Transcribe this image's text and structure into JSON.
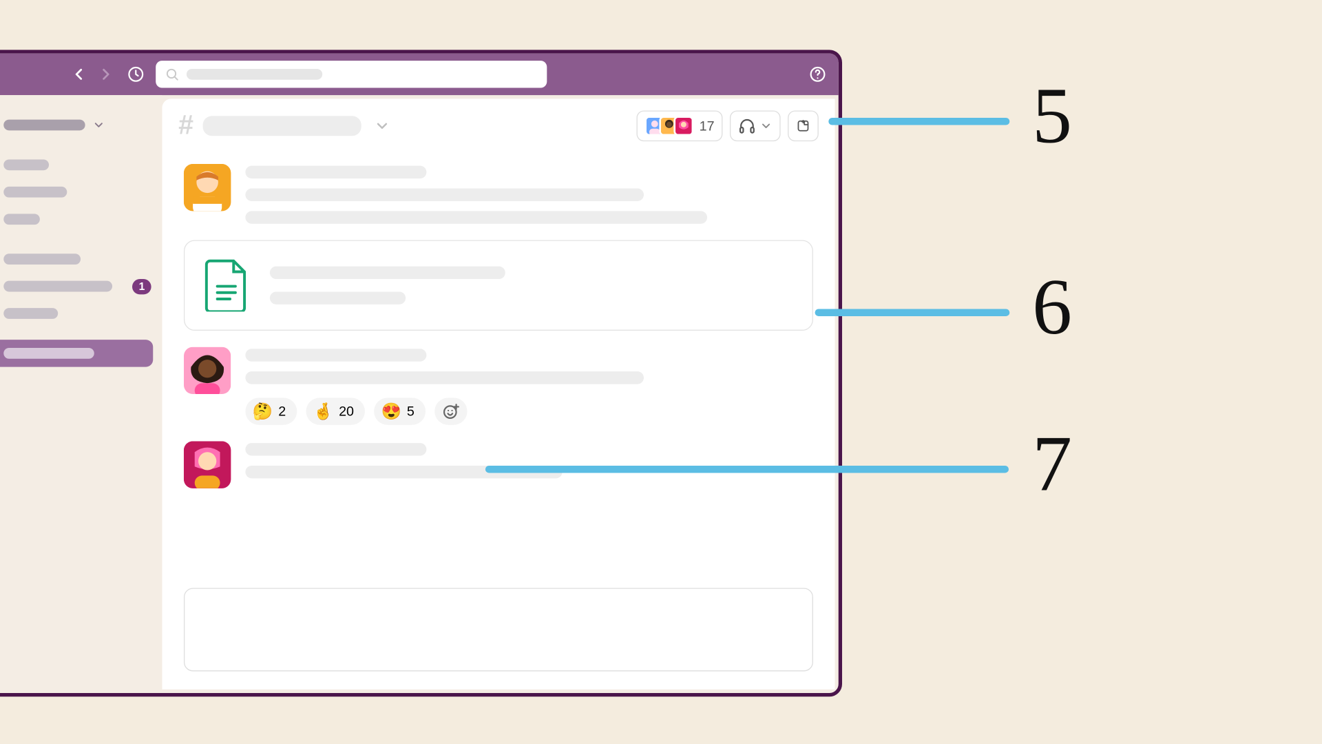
{
  "topbar": {
    "search_placeholder": ""
  },
  "sidebar": {
    "badge_count": "1"
  },
  "channel_header": {
    "member_count": "17"
  },
  "messages": {
    "reactions": [
      {
        "emoji": "🤔",
        "count": "2"
      },
      {
        "emoji": "🤞",
        "count": "20"
      },
      {
        "emoji": "😍",
        "count": "5"
      }
    ]
  },
  "callouts": {
    "five": "5",
    "six": "6",
    "seven": "7"
  }
}
